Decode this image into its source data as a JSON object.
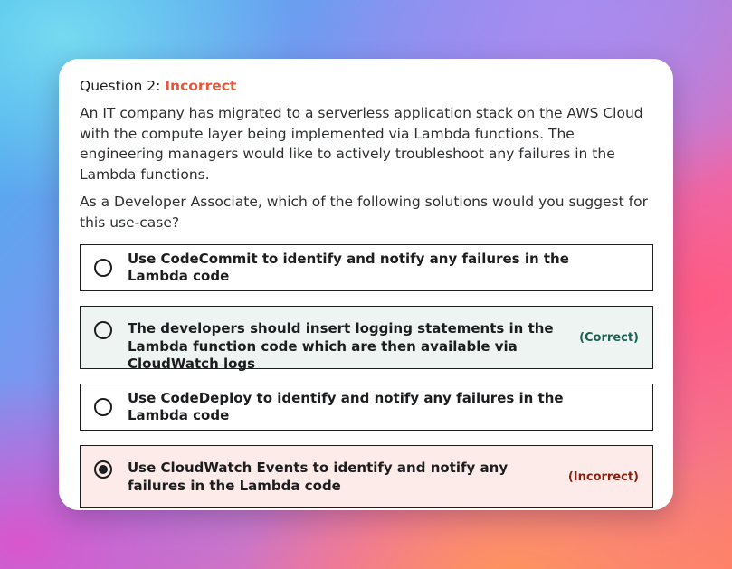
{
  "question": {
    "label": "Question 2:",
    "status": "Incorrect",
    "paragraphs": [
      "An IT company has migrated to a serverless application stack on the AWS Cloud with the compute layer being implemented via Lambda functions. The engineering managers would like to actively troubleshoot any failures in the Lambda functions.",
      "As a Developer Associate, which of the following solutions would you suggest for this use-case?"
    ]
  },
  "answers": [
    {
      "text": "Use CodeCommit to identify and notify any failures in the Lambda code",
      "selected": false,
      "result": ""
    },
    {
      "text": "The developers should insert logging statements in the Lambda function code which are then available via CloudWatch logs",
      "selected": false,
      "result": "(Correct)"
    },
    {
      "text": "Use CodeDeploy to identify and notify any failures in the Lambda code",
      "selected": false,
      "result": ""
    },
    {
      "text": "Use CloudWatch Events to identify and notify any failures in the Lambda code",
      "selected": true,
      "result": "(Incorrect)"
    }
  ],
  "colors": {
    "incorrect_status": "#e2583a",
    "correct_tag": "#1e6055",
    "incorrect_tag": "#8a1f10",
    "correct_bg": "#eef4f2",
    "incorrect_bg": "#fcebe8"
  }
}
